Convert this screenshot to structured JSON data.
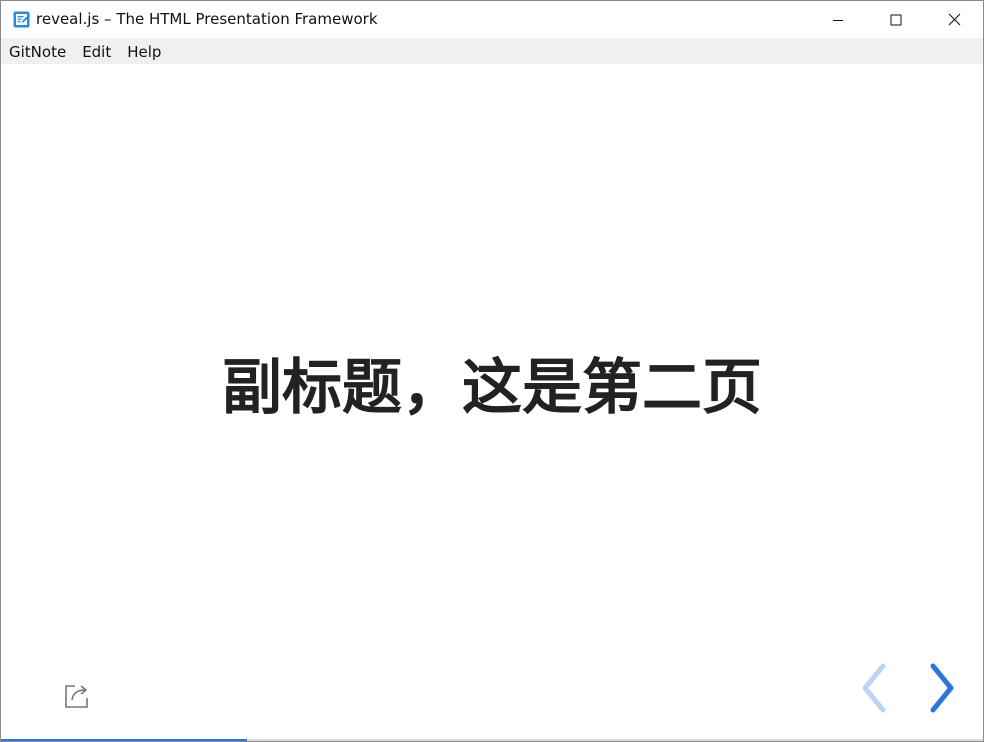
{
  "window": {
    "title": "reveal.js – The HTML Presentation Framework",
    "app_icon": "edit-note-icon"
  },
  "window_controls": {
    "minimize_icon": "minimize-icon",
    "maximize_icon": "maximize-icon",
    "close_icon": "close-icon"
  },
  "menubar": {
    "items": [
      {
        "label": "GitNote"
      },
      {
        "label": "Edit"
      },
      {
        "label": "Help"
      }
    ]
  },
  "slide": {
    "heading": "副标题，这是第二页"
  },
  "controls": {
    "share_icon": "share-icon",
    "prev_icon": "chevron-left-icon",
    "next_icon": "chevron-right-icon",
    "prev_enabled": false,
    "next_enabled": true
  },
  "progress": {
    "fraction": 0.25
  },
  "colors": {
    "accent": "#2a76dd",
    "accent_disabled": "#bcd5f4",
    "menubar_bg": "#f0f0f0",
    "text": "#222222"
  }
}
